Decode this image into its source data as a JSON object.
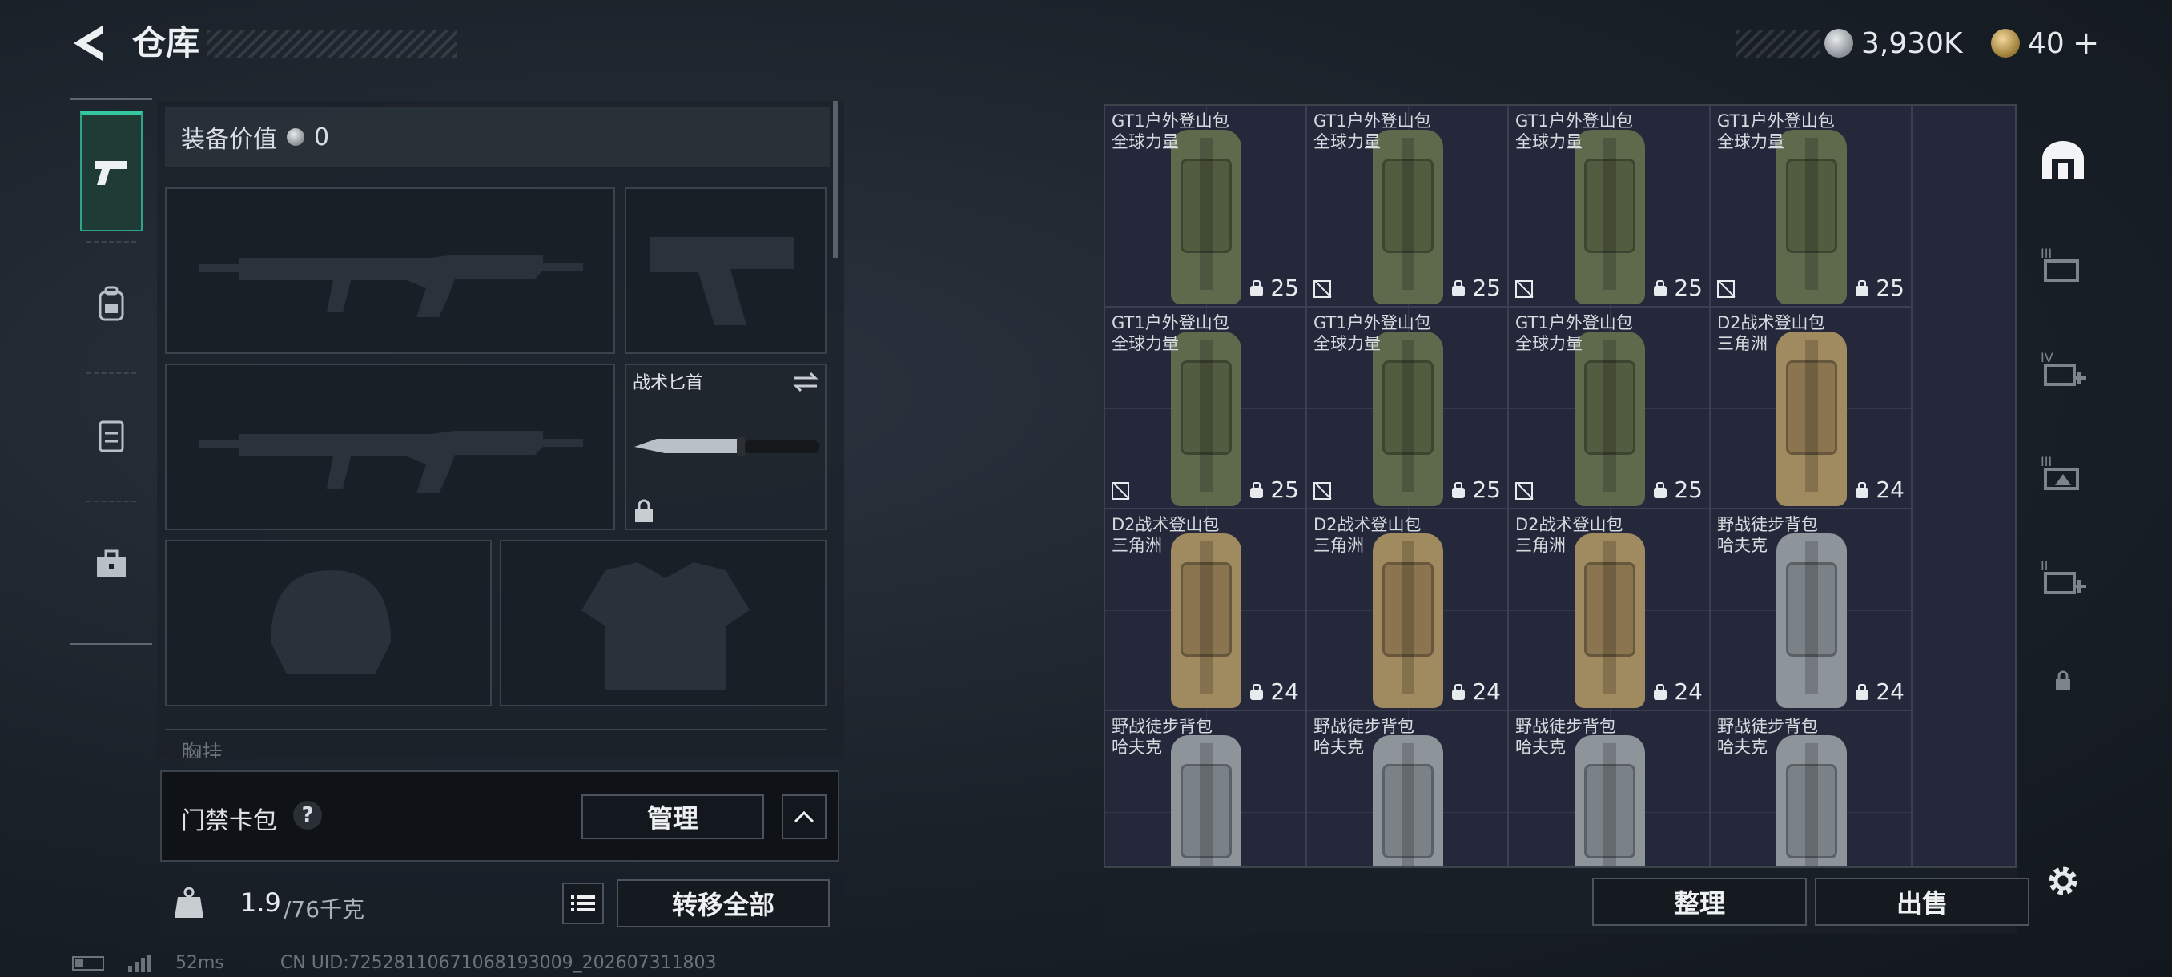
{
  "header": {
    "title": "仓库",
    "silver_amount": "3,930K",
    "gold_amount": "40",
    "gold_add": "+"
  },
  "left_nav": [
    "weapons-icon",
    "backpack-icon",
    "vest-icon",
    "toolbox-icon"
  ],
  "equipment": {
    "value_label": "装备价值",
    "value": "0",
    "melee_name": "战术匕首",
    "chest_label": "胸挂"
  },
  "keycard": {
    "label": "门禁卡包",
    "help": "?",
    "manage_label": "管理"
  },
  "weight": {
    "current": "1.9",
    "max": "/76千克",
    "transfer_all_label": "转移全部"
  },
  "storage": {
    "items": [
      {
        "name": "GT1户外登山包",
        "sub": "全球力量",
        "capacity": "25",
        "no_insure": false,
        "color": "green"
      },
      {
        "name": "GT1户外登山包",
        "sub": "全球力量",
        "capacity": "25",
        "no_insure": true,
        "color": "green"
      },
      {
        "name": "GT1户外登山包",
        "sub": "全球力量",
        "capacity": "25",
        "no_insure": true,
        "color": "green"
      },
      {
        "name": "GT1户外登山包",
        "sub": "全球力量",
        "capacity": "25",
        "no_insure": true,
        "color": "green"
      },
      {
        "name": "GT1户外登山包",
        "sub": "全球力量",
        "capacity": "25",
        "no_insure": true,
        "color": "green"
      },
      {
        "name": "GT1户外登山包",
        "sub": "全球力量",
        "capacity": "25",
        "no_insure": true,
        "color": "green"
      },
      {
        "name": "GT1户外登山包",
        "sub": "全球力量",
        "capacity": "25",
        "no_insure": true,
        "color": "green"
      },
      {
        "name": "D2战术登山包",
        "sub": "三角洲",
        "capacity": "24",
        "no_insure": false,
        "color": "tan"
      },
      {
        "name": "D2战术登山包",
        "sub": "三角洲",
        "capacity": "24",
        "no_insure": false,
        "color": "tan"
      },
      {
        "name": "D2战术登山包",
        "sub": "三角洲",
        "capacity": "24",
        "no_insure": false,
        "color": "tan"
      },
      {
        "name": "D2战术登山包",
        "sub": "三角洲",
        "capacity": "24",
        "no_insure": false,
        "color": "tan"
      },
      {
        "name": "野战徒步背包",
        "sub": "哈夫克",
        "capacity": "24",
        "no_insure": false,
        "color": "gray"
      },
      {
        "name": "野战徒步背包",
        "sub": "哈夫克",
        "capacity": "",
        "no_insure": false,
        "color": "gray"
      },
      {
        "name": "野战徒步背包",
        "sub": "哈夫克",
        "capacity": "",
        "no_insure": false,
        "color": "gray"
      },
      {
        "name": "野战徒步背包",
        "sub": "哈夫克",
        "capacity": "",
        "no_insure": false,
        "color": "gray"
      },
      {
        "name": "野战徒步背包",
        "sub": "哈夫克",
        "capacity": "",
        "no_insure": false,
        "color": "gray"
      }
    ],
    "sort_label": "整理",
    "sell_label": "出售"
  },
  "right_tabs": [
    {
      "icon": "storage-arch-icon",
      "label": ""
    },
    {
      "icon": "expand-storage-icon",
      "label": "III"
    },
    {
      "icon": "expand-storage-icon",
      "label": "IV"
    },
    {
      "icon": "expand-storage-icon",
      "label": "III"
    },
    {
      "icon": "expand-storage-icon",
      "label": "II"
    },
    {
      "icon": "lock-icon",
      "label": ""
    }
  ],
  "status": {
    "ping": "52ms",
    "uid": "CN UID:725281106710681930​09_202607311803"
  },
  "colors": {
    "accent": "#35c79f",
    "green": "#5f6a4c",
    "tan": "#a08a60",
    "gray": "#8d949a"
  }
}
